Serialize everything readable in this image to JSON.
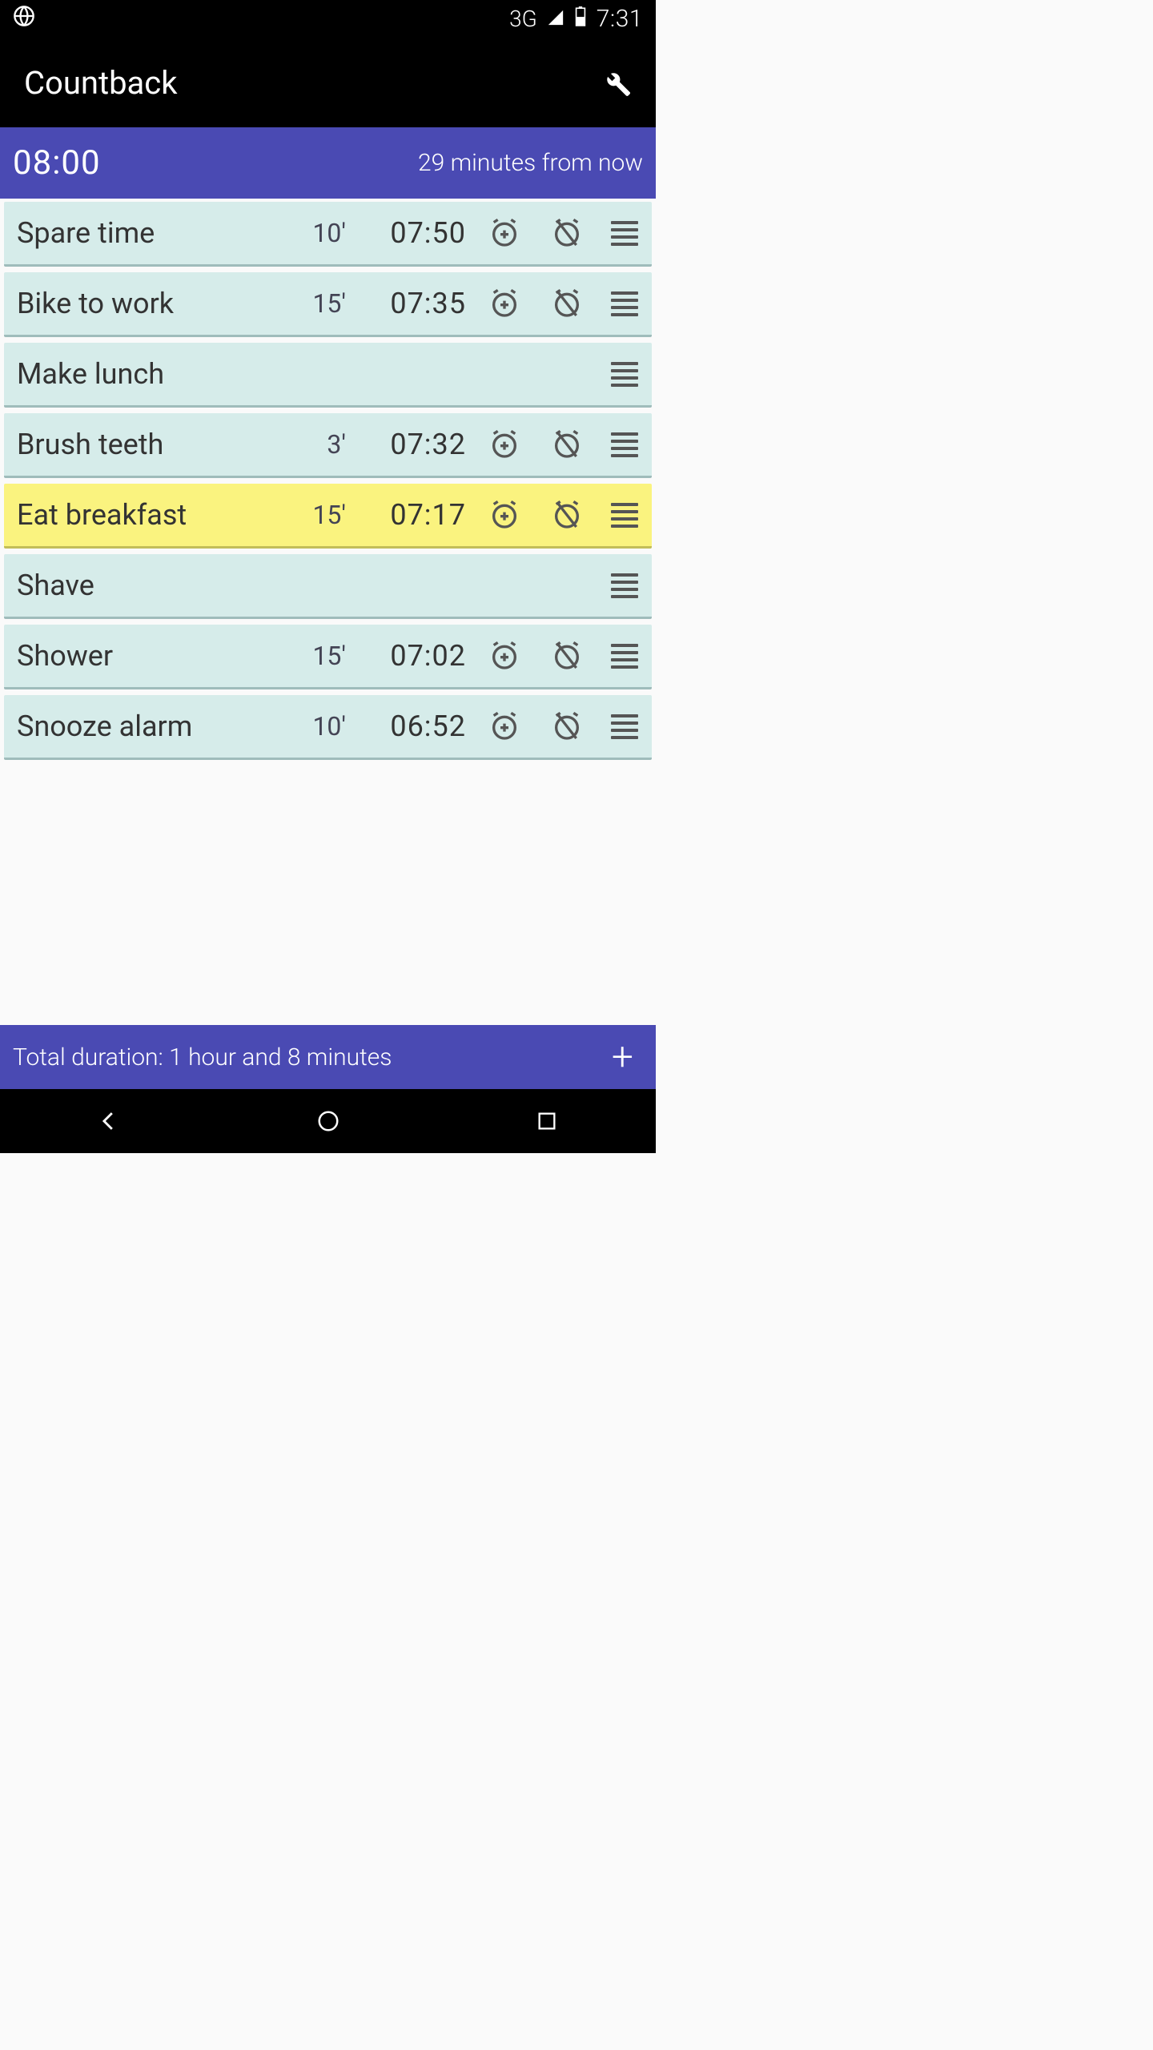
{
  "status_bar": {
    "network_label": "3G",
    "time": "7:31"
  },
  "header": {
    "title": "Countback"
  },
  "target": {
    "time": "08:00",
    "relative": "29 minutes from now"
  },
  "items": [
    {
      "name": "Spare time",
      "duration": "10'",
      "time": "07:50",
      "has_alarm": true,
      "highlight": false
    },
    {
      "name": "Bike to work",
      "duration": "15'",
      "time": "07:35",
      "has_alarm": true,
      "highlight": false
    },
    {
      "name": "Make lunch",
      "duration": "",
      "time": "",
      "has_alarm": false,
      "highlight": false
    },
    {
      "name": "Brush teeth",
      "duration": "3'",
      "time": "07:32",
      "has_alarm": true,
      "highlight": false
    },
    {
      "name": "Eat breakfast",
      "duration": "15'",
      "time": "07:17",
      "has_alarm": true,
      "highlight": true
    },
    {
      "name": "Shave",
      "duration": "",
      "time": "",
      "has_alarm": false,
      "highlight": false
    },
    {
      "name": "Shower",
      "duration": "15'",
      "time": "07:02",
      "has_alarm": true,
      "highlight": false
    },
    {
      "name": "Snooze alarm",
      "duration": "10'",
      "time": "06:52",
      "has_alarm": true,
      "highlight": false
    }
  ],
  "footer": {
    "total_label": "Total duration: 1 hour and 8 minutes"
  }
}
